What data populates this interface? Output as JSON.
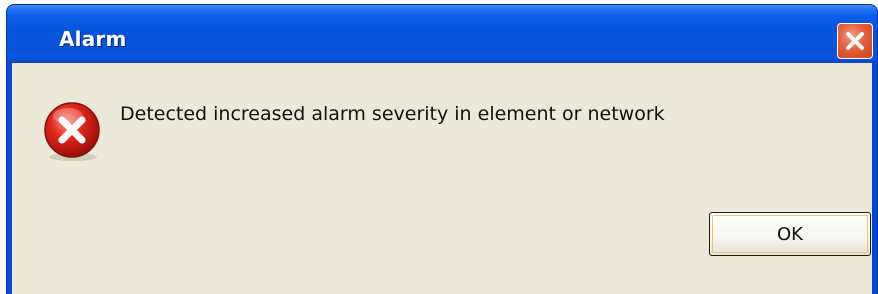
{
  "window": {
    "title": "Alarm"
  },
  "titlebar": {
    "close_icon": "close-icon"
  },
  "dialog": {
    "icon": "error-icon",
    "message": "Detected increased alarm severity in element or network",
    "ok_label": "OK"
  },
  "colors": {
    "titlebar": "#0654dd",
    "client_bg": "#ece9d8",
    "close_button": "#e4603c",
    "error_icon": "#d8251b"
  }
}
